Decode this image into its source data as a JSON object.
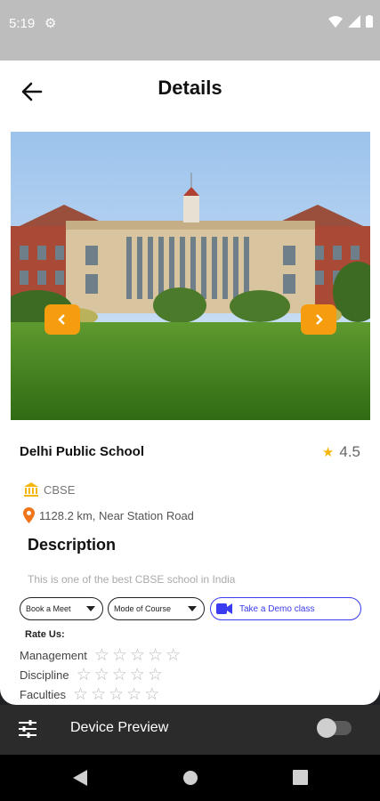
{
  "status_bar": {
    "time": "5:19"
  },
  "app_bar": {
    "title": "Details"
  },
  "school": {
    "name": "Delhi Public School",
    "rating": "4.5",
    "board": "CBSE",
    "location": "1128.2 km, Near Station Road"
  },
  "description": {
    "heading": "Description",
    "text": "This is one of the best CBSE school in India"
  },
  "actions": {
    "book_meet": "Book a Meet",
    "mode_of_course": "Mode of Course",
    "demo": "Take a Demo class"
  },
  "rate": {
    "heading": "Rate Us:",
    "categories": [
      {
        "label": "Management",
        "stars": 0
      },
      {
        "label": "Discipline",
        "stars": 0
      },
      {
        "label": "Faculties",
        "stars": 0
      }
    ]
  },
  "device_preview": {
    "label": "Device Preview",
    "enabled": false
  },
  "colors": {
    "accent": "#f59d0f",
    "demo_blue": "#3b3bf0",
    "star": "#f5b70f"
  }
}
